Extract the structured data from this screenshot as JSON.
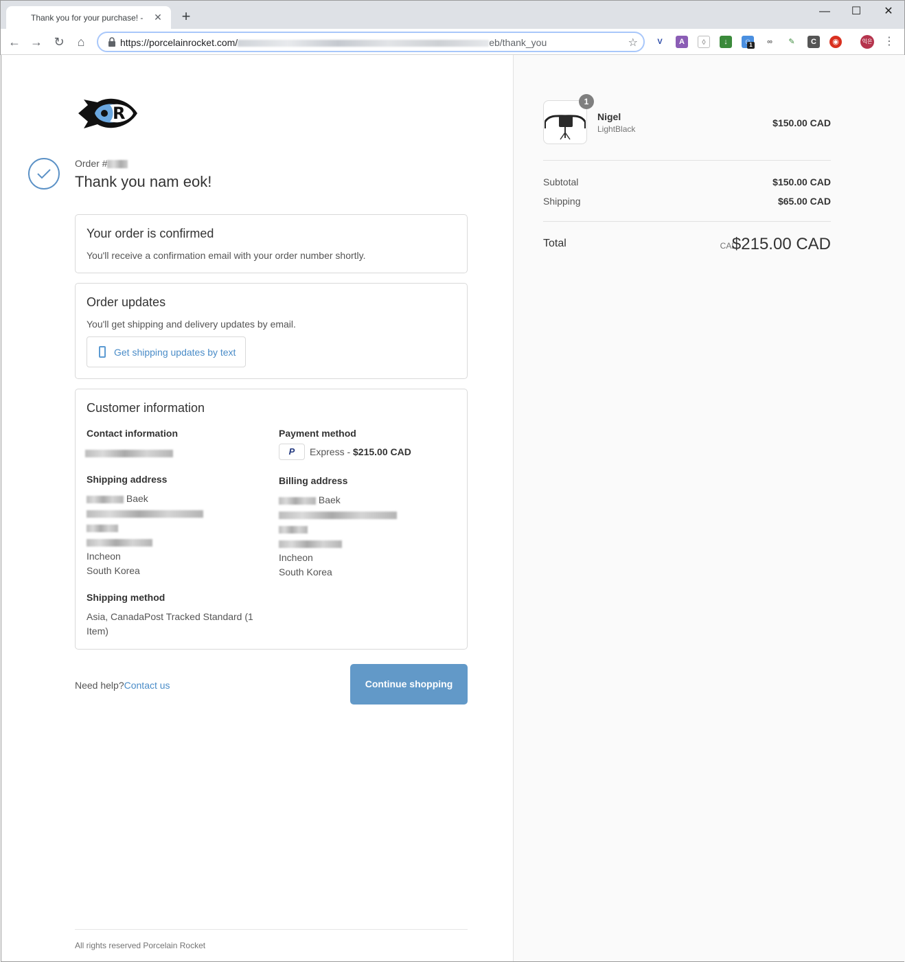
{
  "browser": {
    "tab_title": "Thank you for your purchase! -",
    "tab_close": "✕",
    "new_tab": "+",
    "window_controls": {
      "minimize": "—",
      "maximize": "☐",
      "close": "✕"
    },
    "url_prefix": "https://porcelainrocket.com/",
    "url_suffix": "eb/thank_you",
    "extension_badge": "1",
    "avatar_text": "익은"
  },
  "order": {
    "label": "Order #",
    "thank_you": "Thank you nam eok!"
  },
  "confirmed": {
    "heading": "Your order is confirmed",
    "text": "You'll receive a confirmation email with your order number shortly."
  },
  "updates": {
    "heading": "Order updates",
    "text": "You'll get shipping and delivery updates by email.",
    "button": "Get shipping updates by text"
  },
  "customer": {
    "heading": "Customer information",
    "contact_heading": "Contact information",
    "payment_heading": "Payment method",
    "payment_icon": "P",
    "payment_text": "Express - ",
    "payment_amount": "$215.00 CAD",
    "shipping_heading": "Shipping address",
    "shipping_lines": [
      "Baek",
      "Incheon",
      "South Korea"
    ],
    "billing_heading": "Billing address",
    "billing_lines": [
      "Baek",
      "Incheon",
      "South Korea"
    ],
    "method_heading": "Shipping method",
    "method_text_1": "Asia, CanadaPost Tracked Standard (1",
    "method_text_2": "Item)"
  },
  "help": {
    "text": "Need help?",
    "link": "Contact us"
  },
  "continue_button": "Continue shopping",
  "footer": "All rights reserved Porcelain Rocket",
  "cart": {
    "item": {
      "quantity": "1",
      "name": "Nigel",
      "variant": "LightBlack",
      "price": "$150.00 CAD"
    },
    "subtotal_label": "Subtotal",
    "subtotal": "$150.00 CAD",
    "shipping_label": "Shipping",
    "shipping": "$65.00 CAD",
    "total_label": "Total",
    "total_currency": "CAD",
    "total": "$215.00 CAD"
  },
  "colors": {
    "accent": "#6299c8",
    "link": "#4a8cc8",
    "sidebar_bg": "#fafafa"
  }
}
